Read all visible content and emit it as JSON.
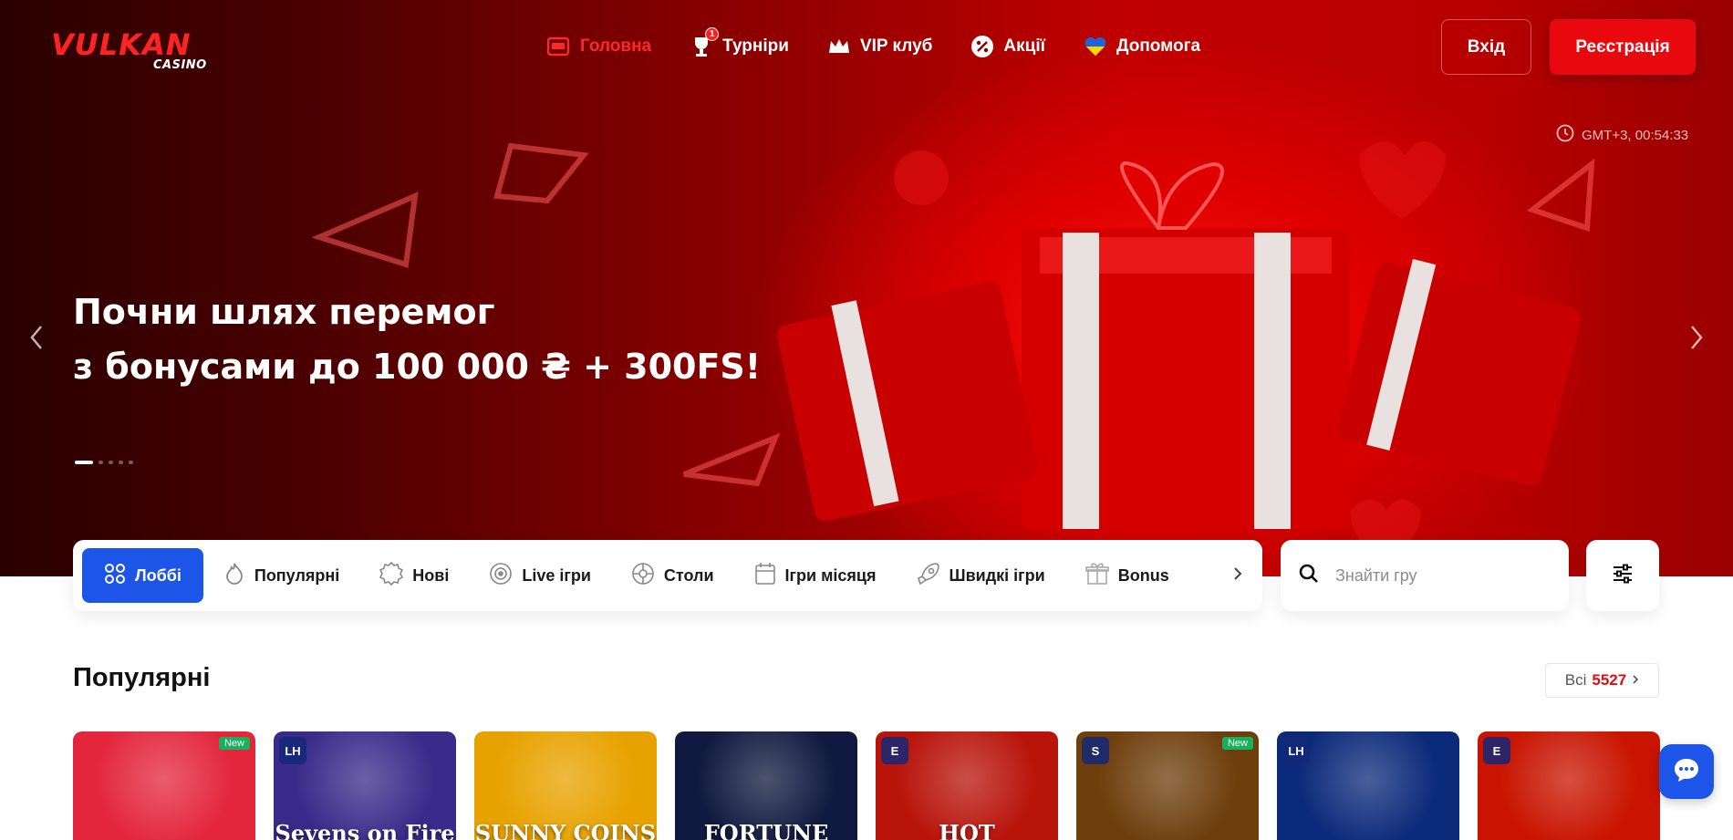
{
  "brand": {
    "logo_text": "VULKAN",
    "logo_sub": "CASINO",
    "accent": "#e8080e",
    "blue": "#1d55e8"
  },
  "nav": [
    {
      "label": "Головна",
      "icon": "slot-machine-icon",
      "active": true
    },
    {
      "label": "Турніри",
      "icon": "trophy-icon",
      "badge": "1"
    },
    {
      "label": "VIP клуб",
      "icon": "crown-icon"
    },
    {
      "label": "Акції",
      "icon": "percent-icon"
    },
    {
      "label": "Допомога",
      "icon": "heart-icon"
    }
  ],
  "auth": {
    "login_label": "Вхід",
    "register_label": "Реєстрація"
  },
  "clock": "GMT+3, 00:54:33",
  "hero": {
    "line1": "Почни шлях перемог",
    "line2": "з бонусами до 100 000 ₴ + 300FS!",
    "slides_total": 5,
    "active_slide": 1
  },
  "categories": [
    {
      "label": "Лоббі",
      "icon": "grid-icon",
      "active": true
    },
    {
      "label": "Популярні",
      "icon": "fire-icon"
    },
    {
      "label": "Нові",
      "icon": "new-icon"
    },
    {
      "label": "Live ігри",
      "icon": "live-icon"
    },
    {
      "label": "Столи",
      "icon": "roulette-icon"
    },
    {
      "label": "Ігри місяця",
      "icon": "calendar-icon"
    },
    {
      "label": "Швидкі ігри",
      "icon": "rocket-icon"
    },
    {
      "label": "Bonus",
      "icon": "gift-icon"
    }
  ],
  "search": {
    "placeholder": "Знайти гру"
  },
  "popular": {
    "title": "Популярні",
    "all_label": "Всі",
    "all_count": "5527"
  },
  "games": [
    {
      "title": "",
      "bg": "#e3263c",
      "new_badge": "New",
      "provider": ""
    },
    {
      "title": "Sevens on Fire",
      "bg": "#3a2a8a",
      "new_badge": "",
      "provider": "LH"
    },
    {
      "title": "SUNNY COINS",
      "bg": "#e8a200",
      "new_badge": "",
      "provider": ""
    },
    {
      "title": "FORTUNE",
      "bg": "#101a40",
      "new_badge": "",
      "provider": ""
    },
    {
      "title": "HOT",
      "bg": "#b8140a",
      "new_badge": "",
      "provider": "E"
    },
    {
      "title": "",
      "bg": "#6e3e0c",
      "new_badge": "New",
      "provider": "S"
    },
    {
      "title": "",
      "bg": "#0c2a7a",
      "new_badge": "",
      "provider": "LH"
    },
    {
      "title": "",
      "bg": "#c81400",
      "new_badge": "",
      "provider": "E"
    }
  ]
}
